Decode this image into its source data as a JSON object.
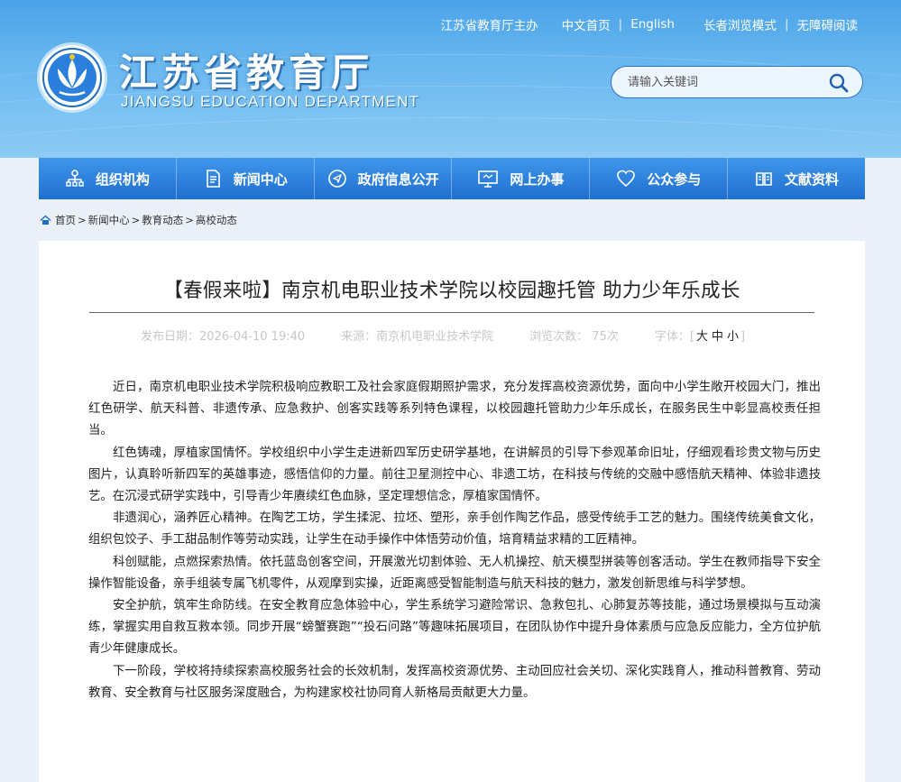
{
  "header": {
    "top_links": [
      "江苏省教育厅主办",
      "中文首页",
      "English",
      "长者浏览模式",
      "无障碍阅读"
    ],
    "site_title": "江苏省教育厅",
    "site_subtitle": "JIANGSU EDUCATION DEPARTMENT",
    "search": {
      "placeholder": "请输入关键词",
      "icon": "search-icon"
    }
  },
  "nav": [
    {
      "label": "组织机构",
      "icon": "org-chart-icon"
    },
    {
      "label": "新闻中心",
      "icon": "document-icon"
    },
    {
      "label": "政府信息公开",
      "icon": "send-icon"
    },
    {
      "label": "网上办事",
      "icon": "monitor-icon"
    },
    {
      "label": "公众参与",
      "icon": "heart-icon"
    },
    {
      "label": "文献资料",
      "icon": "book-icon"
    }
  ],
  "breadcrumb": [
    "首页",
    "新闻中心",
    "教育动态",
    "高校动态"
  ],
  "article": {
    "title": "【春假来啦】南京机电职业技术学院以校园趣托管 助力少年乐成长",
    "published": "发布日期：2026-04-10 19:40",
    "source": "来源：南京机电职业技术学院",
    "views": "浏览次数：  75次",
    "font_label": "字体：",
    "font_open": "[",
    "font_large": "大",
    "font_medium": "中",
    "font_small": "小",
    "font_close": "]",
    "paragraphs": [
      "近日，南京机电职业技术学院积极响应教职工及社会家庭假期照护需求，充分发挥高校资源优势，面向中小学生敞开校园大门，推出红色研学、航天科普、非遗传承、应急救护、创客实践等系列特色课程，以校园趣托管助力少年乐成长，在服务民生中彰显高校责任担当。",
      "红色铸魂，厚植家国情怀。学校组织中小学生走进新四军历史研学基地，在讲解员的引导下参观革命旧址，仔细观看珍贵文物与历史图片，认真聆听新四军的英雄事迹，感悟信仰的力量。前往卫星测控中心、非遗工坊，在科技与传统的交融中感悟航天精神、体验非遗技艺。在沉浸式研学实践中，引导青少年赓续红色血脉，坚定理想信念，厚植家国情怀。",
      "非遗润心，涵养匠心精神。在陶艺工坊，学生揉泥、拉坯、塑形，亲手创作陶艺作品，感受传统手工艺的魅力。围绕传统美食文化，组织包饺子、手工甜品制作等劳动实践，让学生在动手操作中体悟劳动价值，培育精益求精的工匠精神。",
      "科创赋能，点燃探索热情。依托蓝岛创客空间，开展激光切割体验、无人机操控、航天模型拼装等创客活动。学生在教师指导下安全操作智能设备，亲手组装专属飞机零件，从观摩到实操，近距离感受智能制造与航天科技的魅力，激发创新思维与科学梦想。",
      "安全护航，筑牢生命防线。在安全教育应急体验中心，学生系统学习避险常识、急救包扎、心肺复苏等技能，通过场景模拟与互动演练，掌握实用自救互救本领。同步开展“螃蟹赛跑”“投石问路”等趣味拓展项目，在团队协作中提升身体素质与应急反应能力，全方位护航青少年健康成长。",
      "下一阶段，学校将持续探索高校服务社会的长效机制，发挥高校资源优势、主动回应社会关切、深化实践育人，推动科普教育、劳动教育、安全教育与社区服务深度融合，为构建家校社协同育人新格局贡献更大力量。"
    ]
  },
  "colors": {
    "header_top": "#4aa3e8",
    "nav": "#2a7fdc",
    "page_bg": "#e9f0f8"
  }
}
